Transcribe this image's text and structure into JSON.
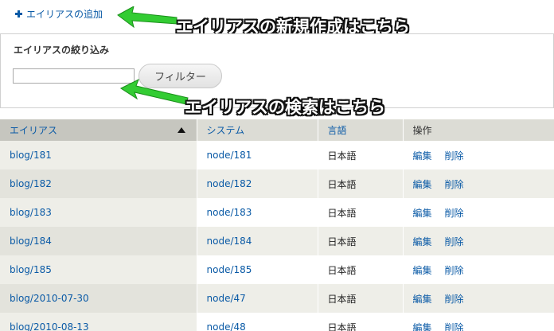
{
  "add_link": {
    "label": "エイリアスの追加",
    "icon": "plus-icon"
  },
  "annotations": {
    "create": "エイリアスの新規作成はこちら",
    "search": "エイリアスの検索はこちら",
    "arrow_color": "#33cc33"
  },
  "filter": {
    "title": "エイリアスの絞り込み",
    "input_value": "",
    "button_label": "フィルター"
  },
  "table": {
    "headers": {
      "alias": "エイリアス",
      "system": "システム",
      "language": "言語",
      "operations": "操作"
    },
    "sort": {
      "column": "alias",
      "direction": "asc"
    },
    "rows": [
      {
        "alias": "blog/181",
        "system": "node/181",
        "language": "日本語",
        "edit": "編集",
        "delete": "削除"
      },
      {
        "alias": "blog/182",
        "system": "node/182",
        "language": "日本語",
        "edit": "編集",
        "delete": "削除"
      },
      {
        "alias": "blog/183",
        "system": "node/183",
        "language": "日本語",
        "edit": "編集",
        "delete": "削除"
      },
      {
        "alias": "blog/184",
        "system": "node/184",
        "language": "日本語",
        "edit": "編集",
        "delete": "削除"
      },
      {
        "alias": "blog/185",
        "system": "node/185",
        "language": "日本語",
        "edit": "編集",
        "delete": "削除"
      },
      {
        "alias": "blog/2010-07-30",
        "system": "node/47",
        "language": "日本語",
        "edit": "編集",
        "delete": "削除"
      },
      {
        "alias": "blog/2010-08-13",
        "system": "node/48",
        "language": "日本語",
        "edit": "編集",
        "delete": "削除"
      }
    ]
  }
}
